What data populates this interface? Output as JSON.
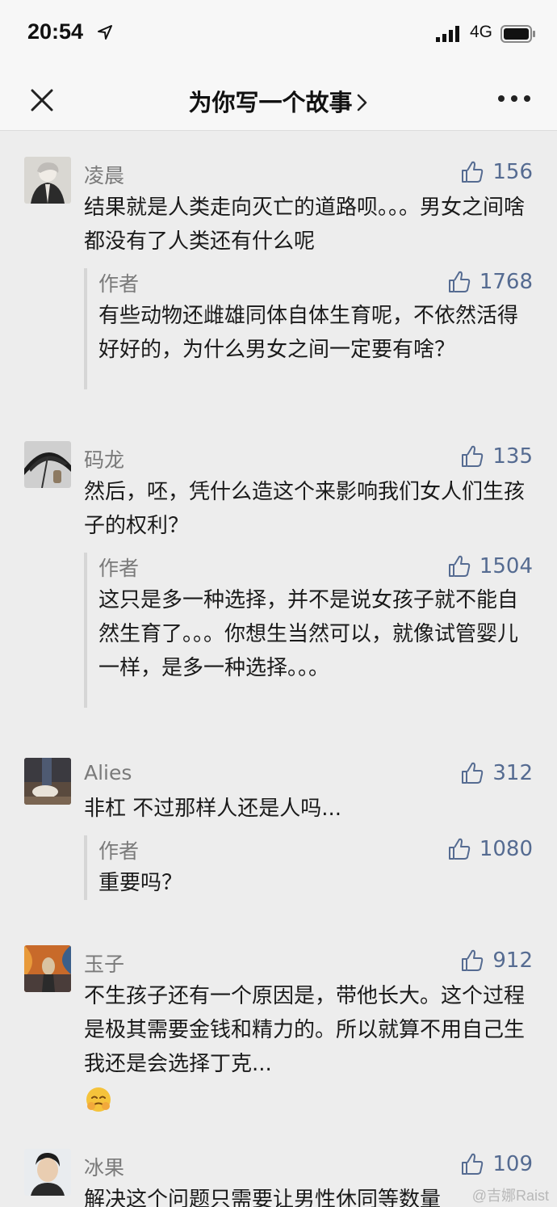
{
  "status_bar": {
    "time": "20:54",
    "network": "4G"
  },
  "nav": {
    "title": "为你写一个故事"
  },
  "comments": [
    {
      "user": "凌晨",
      "likes": "156",
      "text": "结果就是人类走向灭亡的道路呗。。。男女之间啥都没有了人类还有什么呢",
      "reply": {
        "user": "作者",
        "likes": "1768",
        "text": "有些动物还雌雄同体自体生育呢，不依然活得好好的，为什么男女之间一定要有啥？"
      }
    },
    {
      "user": "码龙",
      "likes": "135",
      "text": "然后，呸，凭什么造这个来影响我们女人们生孩子的权利？",
      "reply": {
        "user": "作者",
        "likes": "1504",
        "text": "这只是多一种选择，并不是说女孩子就不能自然生育了。。。你想生当然可以，就像试管婴儿一样，是多一种选择。。。"
      }
    },
    {
      "user": "Alies",
      "likes": "312",
      "text": "非杠 不过那样人还是人吗...",
      "reply": {
        "user": "作者",
        "likes": "1080",
        "text": "重要吗？"
      }
    },
    {
      "user": "玉子",
      "likes": "912",
      "text": "不生孩子还有一个原因是，带他长大。这个过程是极其需要金钱和精力的。所以就算不用自己生我还是会选择丁克...",
      "emoji": "facepalm-emoji"
    },
    {
      "user": "冰果",
      "likes": "109",
      "text": "解决这个问题只需要让男性休同等数量"
    }
  ],
  "watermark": "@吉娜Raist"
}
